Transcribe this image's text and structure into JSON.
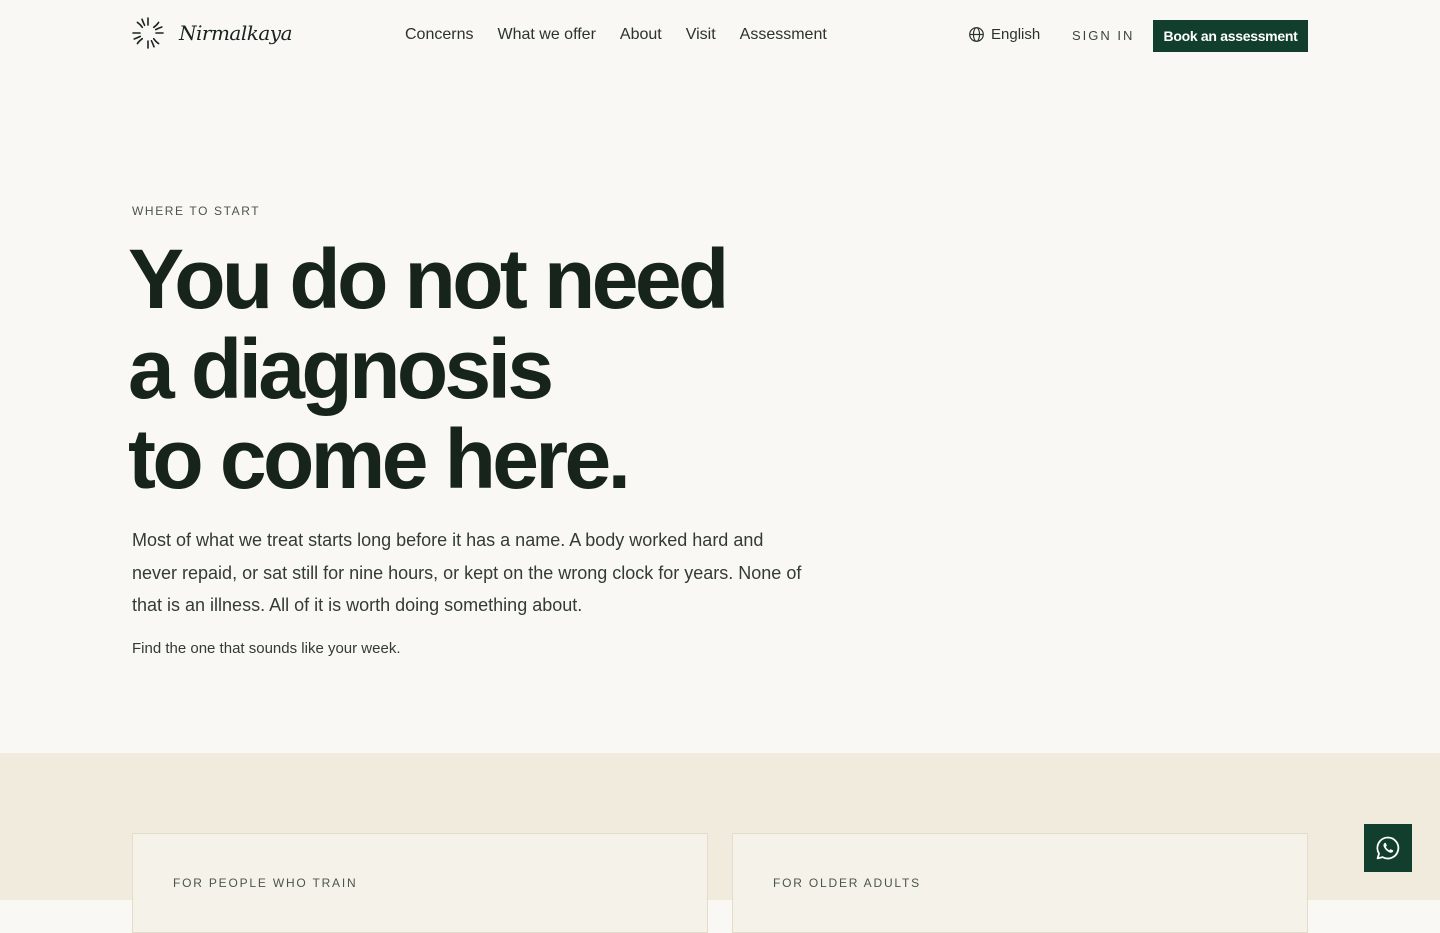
{
  "brand": {
    "name": "Nirmalkaya",
    "logo_icon": "sunburst-logo-icon"
  },
  "nav": {
    "items": [
      "Concerns",
      "What we offer",
      "About",
      "Visit",
      "Assessment"
    ]
  },
  "header": {
    "language": "English",
    "language_icon": "globe-icon",
    "signin": "SIGN IN",
    "cta": "Book an assessment",
    "cta_color": "#123f2d"
  },
  "hero": {
    "eyebrow": "WHERE TO START",
    "headline": [
      "You do not need",
      "a diagnosis",
      "to come here."
    ],
    "lead": "Most of what we treat starts long before it has a name. A body worked hard and never repaid, or sat still for nine hours, or kept on the wrong clock for years. None of that is an illness. All of it is worth doing something about.",
    "sublead": "Find the one that sounds like your week."
  },
  "cards": [
    {
      "label": "FOR PEOPLE WHO TRAIN"
    },
    {
      "label": "FOR OLDER ADULTS"
    }
  ],
  "chat": {
    "icon": "whatsapp-icon"
  },
  "colors": {
    "background": "#f9f8f4",
    "section_background": "#f1ebde",
    "accent": "#123f2d",
    "text": "#17241c"
  }
}
